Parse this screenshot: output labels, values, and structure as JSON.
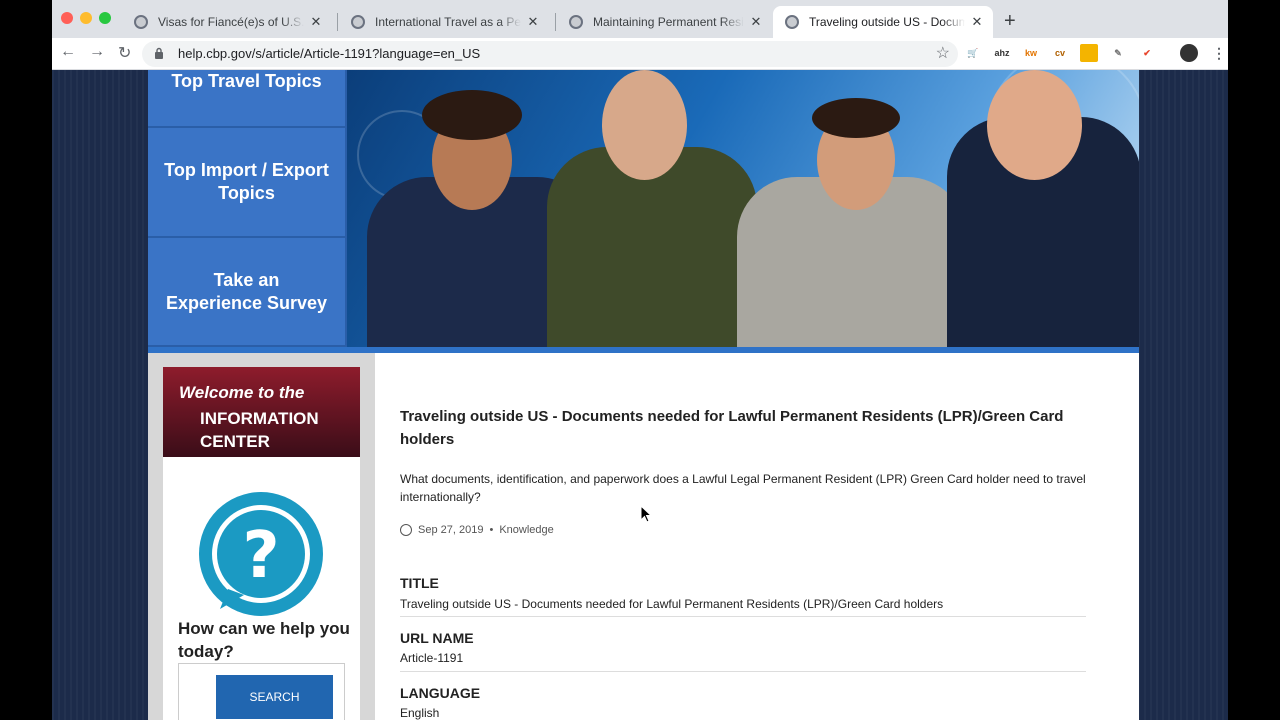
{
  "browser": {
    "tabs": [
      {
        "title": "Visas for Fiancé(e)s of U.S. Citizens"
      },
      {
        "title": "International Travel as a Permanent Resident"
      },
      {
        "title": "Maintaining Permanent Residence"
      },
      {
        "title": "Traveling outside US - Documents needed for Lawful Permanent Residents"
      }
    ],
    "new_tab": "+",
    "url": "help.cbp.gov/s/article/Article-1191?language=en_US",
    "close_glyph": "✕",
    "extensions": [
      "ahz",
      "kw",
      "cv"
    ]
  },
  "sidebar_menu": [
    {
      "label": "Top Travel Topics"
    },
    {
      "label": "Top Import / Export Topics"
    },
    {
      "label": "Take an Experience Survey"
    }
  ],
  "welcome": {
    "line1": "Welcome to the",
    "line2": "INFORMATION CENTER"
  },
  "help": {
    "question": "How can we help you today?",
    "search_label": "SEARCH"
  },
  "article": {
    "title": "Traveling outside US - Documents needed for Lawful Permanent Residents (LPR)/Green Card holders",
    "summary": "What documents, identification, and paperwork does a Lawful Legal Permanent Resident (LPR) Green Card holder need to travel internationally?",
    "date": "Sep 27, 2019",
    "type": "Knowledge",
    "fields": [
      {
        "label": "TITLE",
        "value": "Traveling outside US - Documents needed for Lawful Permanent Residents (LPR)/Green Card holders"
      },
      {
        "label": "URL NAME",
        "value": "Article-1191"
      },
      {
        "label": "LANGUAGE",
        "value": "English"
      }
    ]
  },
  "colors": {
    "menu_blue": "#3a74c6",
    "welcome_red": "#8e1c2c",
    "accent_blue": "#2f72c7"
  }
}
